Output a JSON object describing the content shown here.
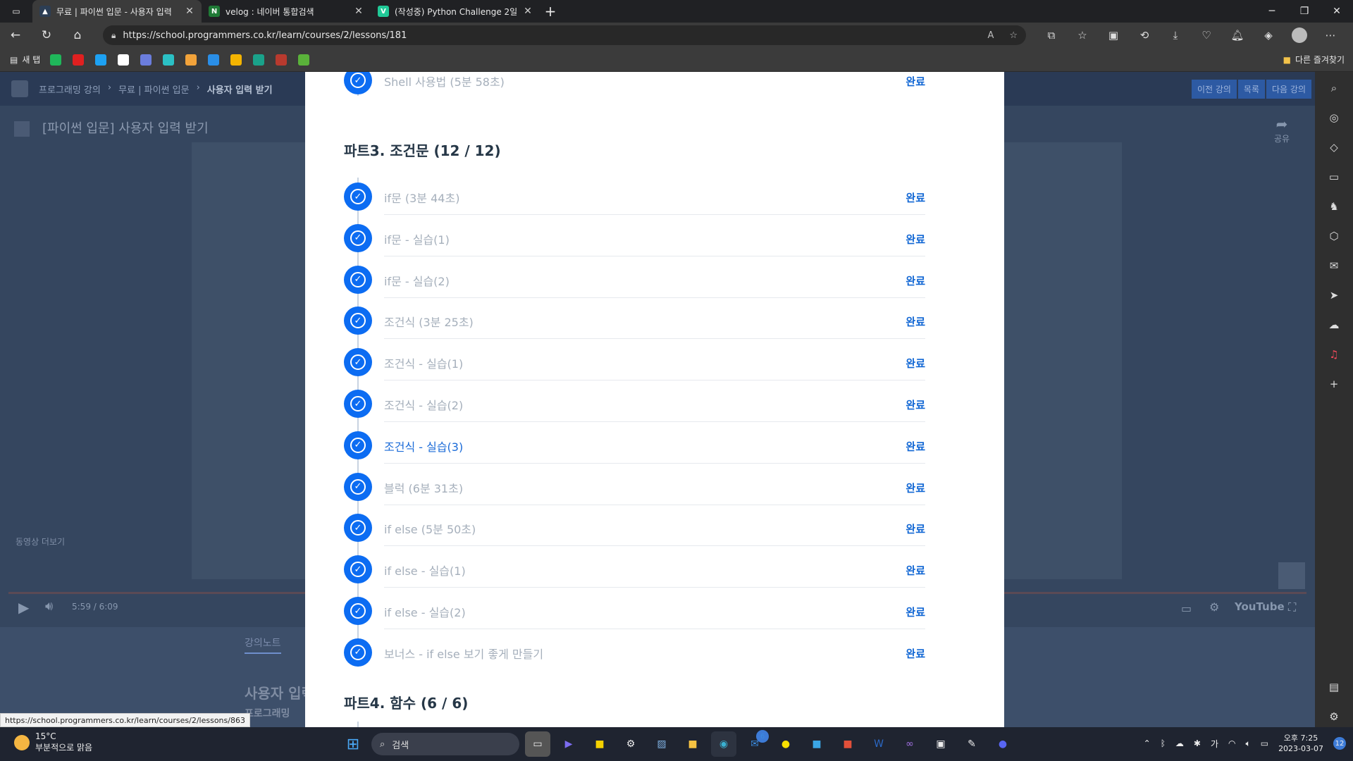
{
  "tabs": [
    {
      "title": "무료 | 파이썬 입문 - 사용자 입력",
      "fav_color": "#2c3e55",
      "fav_glyph": "▲",
      "active": true
    },
    {
      "title": "velog : 네이버 통합검색",
      "fav_color": "#1f7a36",
      "fav_glyph": "N",
      "active": false
    },
    {
      "title": "(작성중) Python Challenge 2일차",
      "fav_color": "#20c997",
      "fav_glyph": "V",
      "active": false
    }
  ],
  "address": {
    "url": "https://school.programmers.co.kr/learn/courses/2/lessons/181"
  },
  "bookmarks": {
    "first": "새 탭",
    "other": "다른 즐겨찾기",
    "icons": [
      "#1fb75a",
      "#e02020",
      "#1da1f2",
      "#ffffff",
      "#6b7ddc",
      "#2bc0c4",
      "#f2a33a",
      "#2a8ee6",
      "#f4b400",
      "#1aa28a",
      "#b83a2e",
      "#5ab23a"
    ]
  },
  "page": {
    "crumbs": [
      "프로그래밍 강의",
      "무료 | 파이썬 입문",
      "사용자 입력 받기"
    ],
    "nav_buttons": [
      "이전 강의",
      "목록",
      "다음 강의"
    ],
    "video_title": "[파이썬 입문] 사용자 입력 받기",
    "share": "공유",
    "more_videos": "동영상 더보기",
    "time": "5:59 / 6:09",
    "youtube": "YouTube",
    "note_tab": "강의노트",
    "lower_heading": "사용자 입력",
    "lower_sub": "프로그래밍"
  },
  "modal": {
    "top_lesson": {
      "title": "Shell 사용법 (5분 58초)",
      "status": "완료"
    },
    "part3": {
      "title": "파트3. 조건문 (12 / 12)",
      "lessons": [
        {
          "title": "if문 (3분 44초)",
          "status": "완료",
          "current": false
        },
        {
          "title": "if문 - 실습(1)",
          "status": "완료",
          "current": false
        },
        {
          "title": "if문 - 실습(2)",
          "status": "완료",
          "current": false
        },
        {
          "title": "조건식 (3분 25초)",
          "status": "완료",
          "current": false
        },
        {
          "title": "조건식 - 실습(1)",
          "status": "완료",
          "current": false
        },
        {
          "title": "조건식 - 실습(2)",
          "status": "완료",
          "current": false
        },
        {
          "title": "조건식 - 실습(3)",
          "status": "완료",
          "current": true
        },
        {
          "title": "블럭 (6분 31초)",
          "status": "완료",
          "current": false
        },
        {
          "title": "if else (5분 50초)",
          "status": "완료",
          "current": false
        },
        {
          "title": "if else - 실습(1)",
          "status": "완료",
          "current": false
        },
        {
          "title": "if else - 실습(2)",
          "status": "완료",
          "current": false
        },
        {
          "title": "보너스 - if else 보기 좋게 만들기",
          "status": "완료",
          "current": false
        }
      ]
    },
    "part4": {
      "title": "파트4. 함수 (6 / 6)"
    }
  },
  "status_url": "https://school.programmers.co.kr/learn/courses/2/lessons/863",
  "taskbar": {
    "temp": "15°C",
    "weather": "부분적으로 맑음",
    "search": "검색",
    "mail_badge": "6",
    "ime": "가",
    "time": "오후 7:25",
    "date": "2023-03-07",
    "notif": "12"
  }
}
